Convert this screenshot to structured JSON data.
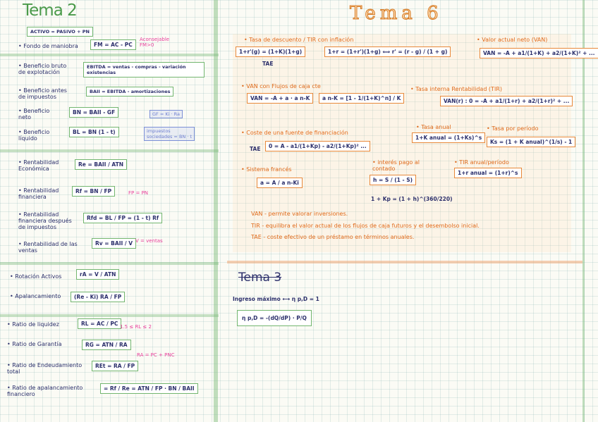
{
  "tema2": {
    "title": "Tema 2",
    "activo": "ACTIVO = PASIVO + PN",
    "fondo_label": "• Fondo de maniobra",
    "fondo_formula": "FM = AC - PC",
    "fondo_note": "Aconsejable\nFM>0",
    "bruto_label": "• Beneficio bruto\nde explotación",
    "bruto_formula": "EBITDA = ventas - compras - variación existencias",
    "antes_label": "• Beneficio antes\nde impuestos",
    "antes_formula": "BAII = EBITDA - amortizaciones",
    "neto_label": "• Beneficio\nneto",
    "neto_formula": "BN = BAII - GF",
    "gf_box": "GF = Ki · Ra",
    "liquido_label": "• Beneficio\nlíquido",
    "liquido_formula": "BL = BN (1 - t)",
    "impuestos_box": "impuestos\nsociedades = BN · t",
    "re_label": "• Rentabilidad\nEconómica",
    "re_formula": "Re = BAII / ATN",
    "rf_label": "• Rentabilidad\nfinanciera",
    "rf_formula": "Rf = BN / FP",
    "rf_note": "FP = PN",
    "rfd_label": "• Rentabilidad\nfinanciera después\nde impuestos",
    "rfd_formula": "Rfd = BL / FP = (1 - t) Rf",
    "rv_label": "• Rentabilidad de las\nventas",
    "rv_formula": "Rv = BAII / V",
    "rv_note": "V = ventas",
    "rot_label": "• Rotación Activos",
    "rot_formula": "rA = V / ATN",
    "apal_label": "• Apalancamiento",
    "apal_formula": "(Re - Ki) RA / FP",
    "liq_label": "• Ratio de liquidez",
    "liq_formula": "RL = AC / PC",
    "liq_note": "1.5 ≤ RL ≤ 2",
    "gar_label": "• Ratio de Garantía",
    "gar_formula": "RG = ATN / RA",
    "gar_note": "RA = PC + PNC",
    "end_label": "• Ratio de Endeudamiento\ntotal",
    "end_formula": "REt = RA / FP",
    "apr_label": "• Ratio de apalancamiento\nfinanciero",
    "apr_formula": "= Rf / Re = ATN / FP · BN / BAII"
  },
  "tema6": {
    "title": "Tema 6",
    "tir_inf_label": "• Tasa de descuento / TIR con inflación",
    "tir_inf_f1": "1+r'(g) = (1+K)(1+g)",
    "tir_inf_f2": "1+r = (1+r')(1+g)  ⟺  r' = (r - g) / (1 + g)",
    "tae": "TAE",
    "van_label": "• Valor actual neto (VAN)",
    "van_formula": "VAN = -A + a1/(1+K) + a2/(1+K)² + ...",
    "vanc_label": "• VAN con Flujos de caja cte",
    "vanc_f1": "VAN = -A + a · a n-K",
    "vanc_f2": "a n-K = [1 - 1/(1+K)^n] / K",
    "tir_label": "• Tasa interna Rentabilidad (TIR)",
    "tir_formula": "VAN(r) : 0 = -A + a1/(1+r) + a2/(1+r)² + ...",
    "coste_label": "• Coste de una fuente de financiación",
    "coste_tae": "TAE",
    "coste_formula": "0 = A - a1/(1+Kp) - a2/(1+Kp)² ...",
    "tasa_anual_label": "• Tasa anual",
    "tasa_anual_formula": "1+K anual = (1+Ks)^s",
    "tasa_periodo_label": "• Tasa por período",
    "tasa_periodo_formula": "Ks = (1 + K anual)^(1/s) - 1",
    "sistema_label": "• Sistema francés",
    "sistema_formula": "a = A / a n-Ki",
    "interes_label": "• interés pago al\ncontado",
    "interes_formula": "h = S / (1 - S)",
    "interes_formula2": "1 + Kp = (1 + h)^(360/220)",
    "tir_anual_label": "• TIR anual/período",
    "tir_anual_formula": "1+r anual = (1+r)^s",
    "def_van": "VAN - permite valorar inversiones.",
    "def_tir": "TIR - equilibra el valor actual de los flujos de caja futuros y el desembolso inicial.",
    "def_tae": "TAE - coste efectivo de un préstamo en términos anuales."
  },
  "tema3": {
    "title": "Tema 3",
    "ingreso": "Ingreso máximo ⟷ η p,D = 1",
    "formula": "η p,D = -(dQ/dP) · P/Q"
  },
  "colors": {
    "ink": "#2b2f6b",
    "green": "#73b66f",
    "orange": "#e8893a",
    "pink": "#e83f9b",
    "blue": "#7b8fd6"
  }
}
